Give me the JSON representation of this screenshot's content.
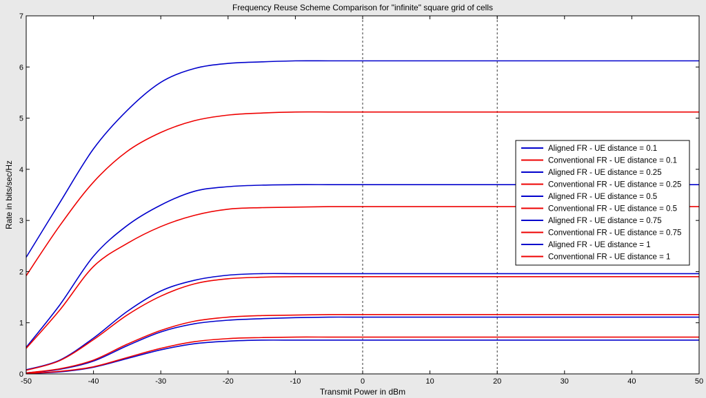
{
  "chart_data": {
    "type": "line",
    "title": "Frequency Reuse Scheme Comparison for \"infinite\" square grid of cells",
    "xlabel": "Transmit Power in dBm",
    "ylabel": "Rate in bits/sec/Hz",
    "xlim": [
      -50,
      50
    ],
    "ylim": [
      0,
      7
    ],
    "xticks": [
      -50,
      -40,
      -30,
      -20,
      -10,
      0,
      10,
      20,
      30,
      40,
      50
    ],
    "yticks": [
      0,
      1,
      2,
      3,
      4,
      5,
      6,
      7
    ],
    "vlines": [
      0,
      20
    ],
    "grid": false,
    "legend_position": "right",
    "x": [
      -50,
      -45,
      -40,
      -35,
      -30,
      -25,
      -20,
      -15,
      -10,
      -5,
      0,
      10,
      20,
      30,
      40,
      50
    ],
    "series": [
      {
        "name": "Aligned FR - UE distance = 0.1",
        "color": "#0000cc",
        "values": [
          2.28,
          3.35,
          4.4,
          5.15,
          5.7,
          5.97,
          6.07,
          6.1,
          6.12,
          6.12,
          6.12,
          6.12,
          6.12,
          6.12,
          6.12,
          6.12
        ]
      },
      {
        "name": "Conventional FR - UE distance = 0.1",
        "color": "#ee0000",
        "values": [
          1.92,
          2.9,
          3.75,
          4.35,
          4.72,
          4.95,
          5.06,
          5.1,
          5.12,
          5.12,
          5.12,
          5.12,
          5.12,
          5.12,
          5.12,
          5.12
        ]
      },
      {
        "name": "Aligned FR - UE distance = 0.25",
        "color": "#0000cc",
        "values": [
          0.52,
          1.35,
          2.3,
          2.9,
          3.3,
          3.57,
          3.66,
          3.69,
          3.7,
          3.7,
          3.7,
          3.7,
          3.7,
          3.7,
          3.7,
          3.7
        ]
      },
      {
        "name": "Conventional FR - UE distance = 0.25",
        "color": "#ee0000",
        "values": [
          0.5,
          1.25,
          2.1,
          2.55,
          2.88,
          3.1,
          3.22,
          3.25,
          3.26,
          3.27,
          3.27,
          3.27,
          3.27,
          3.27,
          3.27,
          3.27
        ]
      },
      {
        "name": "Aligned FR - UE distance = 0.5",
        "color": "#0000cc",
        "values": [
          0.08,
          0.27,
          0.7,
          1.22,
          1.62,
          1.83,
          1.93,
          1.96,
          1.96,
          1.96,
          1.96,
          1.96,
          1.96,
          1.96,
          1.96,
          1.96
        ]
      },
      {
        "name": "Conventional FR - UE distance = 0.5",
        "color": "#ee0000",
        "values": [
          0.07,
          0.26,
          0.67,
          1.15,
          1.52,
          1.76,
          1.86,
          1.89,
          1.9,
          1.9,
          1.9,
          1.9,
          1.9,
          1.9,
          1.9,
          1.9
        ]
      },
      {
        "name": "Aligned FR - UE distance = 0.75",
        "color": "#0000cc",
        "values": [
          0.02,
          0.09,
          0.25,
          0.55,
          0.82,
          0.98,
          1.05,
          1.08,
          1.1,
          1.11,
          1.11,
          1.11,
          1.11,
          1.11,
          1.11,
          1.11
        ]
      },
      {
        "name": "Conventional FR - UE distance = 0.75",
        "color": "#ee0000",
        "values": [
          0.02,
          0.1,
          0.27,
          0.58,
          0.85,
          1.03,
          1.11,
          1.14,
          1.15,
          1.16,
          1.16,
          1.16,
          1.16,
          1.16,
          1.16,
          1.16
        ]
      },
      {
        "name": "Aligned FR - UE distance = 1",
        "color": "#0000cc",
        "values": [
          0.01,
          0.04,
          0.13,
          0.3,
          0.47,
          0.59,
          0.64,
          0.66,
          0.66,
          0.66,
          0.66,
          0.66,
          0.66,
          0.66,
          0.66,
          0.66
        ]
      },
      {
        "name": "Conventional FR - UE distance = 1",
        "color": "#ee0000",
        "values": [
          0.01,
          0.05,
          0.14,
          0.32,
          0.5,
          0.63,
          0.69,
          0.71,
          0.72,
          0.72,
          0.72,
          0.72,
          0.72,
          0.72,
          0.72,
          0.72
        ]
      }
    ]
  }
}
